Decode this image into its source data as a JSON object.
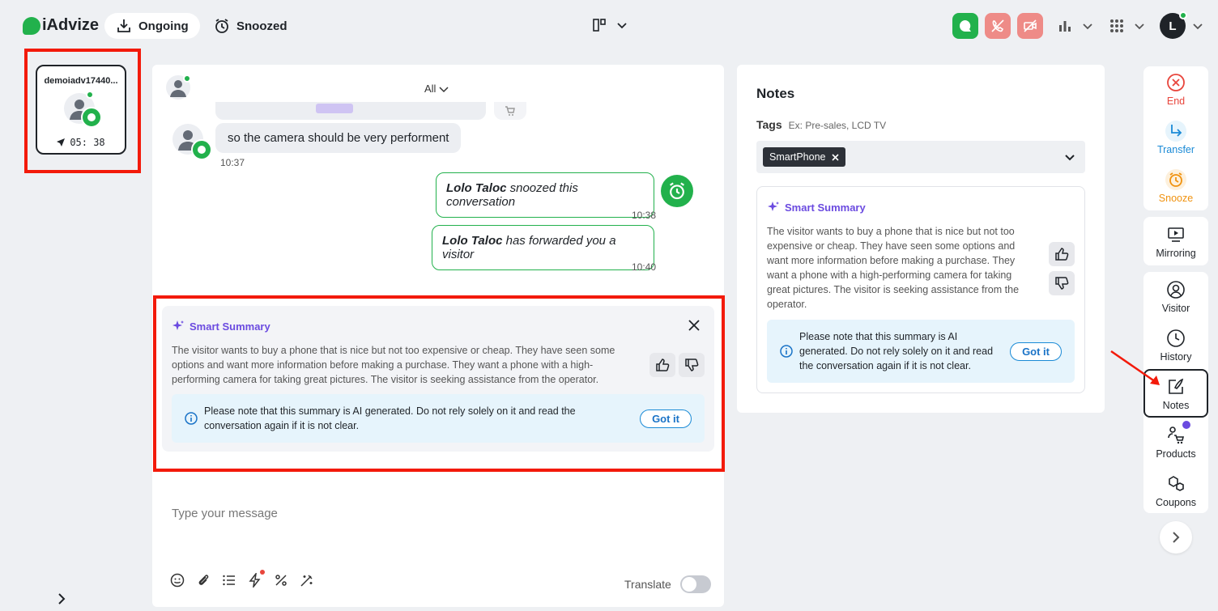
{
  "brand": {
    "name": "iAdvize"
  },
  "top_tabs": [
    {
      "label": "Ongoing"
    },
    {
      "label": "Snoozed"
    }
  ],
  "top_icons": [
    "chat-icon",
    "phone-off-icon",
    "video-off-icon",
    "stats-icon",
    "apps-grid-icon"
  ],
  "user": {
    "initial": "L"
  },
  "conversation_card": {
    "name": "demoiadv17440...",
    "timer": "05: 38"
  },
  "chat": {
    "filter": "All",
    "messages": [
      {
        "type": "visitor",
        "text": "so the camera should be very performent",
        "time": "10:37"
      },
      {
        "type": "event",
        "actor": "Lolo Taloc",
        "text": " snoozed this conversation",
        "time": "10:38"
      },
      {
        "type": "event",
        "actor": "Lolo Taloc",
        "text": " has forwarded you a visitor",
        "time": "10:40"
      }
    ],
    "smart_summary": {
      "title": "Smart Summary",
      "text": "The visitor wants to buy a phone that is nice but not too expensive or cheap. They have seen some options and want more information before making a purchase. They want a phone with a high-performing camera for taking great pictures. The visitor is seeking assistance from the operator.",
      "notice": "Please note that this summary is AI generated. Do not rely solely on it and read the conversation again if it is not clear.",
      "button": "Got it"
    },
    "composer": {
      "placeholder": "Type your message",
      "translate_label": "Translate"
    }
  },
  "notes": {
    "title": "Notes",
    "tags_label": "Tags",
    "tags_placeholder": "Ex: Pre-sales, LCD TV",
    "tags": [
      "SmartPhone"
    ],
    "smart_summary": {
      "title": "Smart Summary",
      "text": "The visitor wants to buy a phone that is nice but not too expensive or cheap. They have seen some options and want more information before making a purchase. They want a phone with a high-performing camera for taking great pictures. The visitor is seeking assistance from the operator.",
      "notice": "Please note that this summary is AI generated. Do not rely solely on it and read the conversation again if it is not clear.",
      "button": "Got it"
    }
  },
  "rail": {
    "end": "End",
    "transfer": "Transfer",
    "snooze": "Snooze",
    "mirroring": "Mirroring",
    "visitor": "Visitor",
    "history": "History",
    "notes": "Notes",
    "products": "Products",
    "coupons": "Coupons"
  },
  "colors": {
    "brand_green": "#22b14c",
    "accent_purple": "#6b4be0",
    "highlight_red": "#f31a0a",
    "danger_red": "#e8453c",
    "transfer_blue": "#1a8ad6",
    "snooze_orange": "#f0920f"
  }
}
